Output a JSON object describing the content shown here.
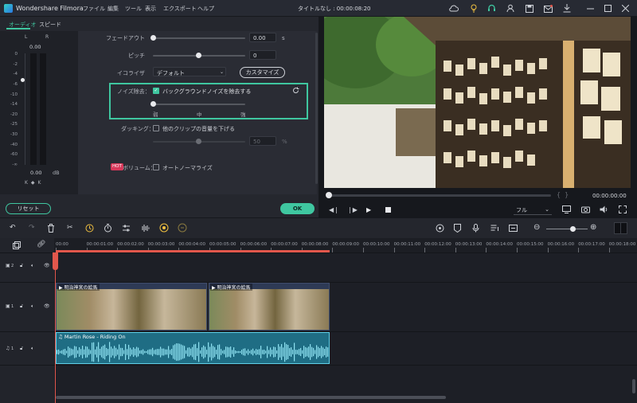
{
  "titlebar": {
    "app_name": "Wondershare Filmora",
    "menus": [
      "ファイル",
      "編集",
      "ツール",
      "表示",
      "エクスポート",
      "ヘルプ"
    ],
    "document_title": "タイトルなし : 00:00:08:20"
  },
  "left_panel": {
    "tabs": [
      {
        "label": "オーディオ",
        "active": true
      },
      {
        "label": "スピード",
        "active": false
      }
    ],
    "meter": {
      "channel_left": "L",
      "channel_right": "R",
      "peak_value": "0.00",
      "scale": [
        "0",
        "-2",
        "-4",
        "-6",
        "-10",
        "-14",
        "-20",
        "-25",
        "-30",
        "-40",
        "-60",
        "-∞"
      ],
      "bottom_value": "0.00",
      "bottom_unit": "dB"
    },
    "settings": {
      "fade_out": {
        "label": "フェードアウト",
        "value": "0.00",
        "unit": "s",
        "level": 0.0
      },
      "pitch": {
        "label": "ピッチ",
        "value": "0",
        "level": 0.5
      },
      "equalizer": {
        "label": "イコライザ",
        "value": "デフォルト",
        "button": "カスタマイズ"
      },
      "noise_removal": {
        "label": "ノイズ除去：",
        "checkbox_label": "バックグラウンドノイズを除去する",
        "checked": true,
        "levels": [
          "弱",
          "中",
          "強"
        ],
        "level": 0.0
      },
      "ducking": {
        "label": "ダッキング：",
        "checkbox_label": "他のクリップの音量を下げる",
        "checked": false,
        "value": "50",
        "unit": "%",
        "level": 0.5
      },
      "auto_normalize": {
        "badge": "HOT",
        "label": "ボリューム：",
        "checkbox_label": "オートノーマライズ",
        "checked": false
      }
    },
    "reset_button": "リセット",
    "ok_button": "OK"
  },
  "preview": {
    "timecode": "00:00:00:00",
    "quality": "フル",
    "progress": 0.0
  },
  "timeline": {
    "ruler": [
      "00:00",
      "00:00:01:00",
      "00:00:02:00",
      "00:00:03:00",
      "00:00:04:00",
      "00:00:05:00",
      "00:00:06:00",
      "00:00:07:00",
      "00:00:08:00",
      "00:00:09:00",
      "00:00:10:00",
      "00:00:11:00",
      "00:00:12:00",
      "00:00:13:00",
      "00:00:14:00",
      "00:00:15:00",
      "00:00:16:00",
      "00:00:17:00",
      "00:00:18:00"
    ],
    "tracks": [
      {
        "id": "2",
        "type": "video"
      },
      {
        "id": "1",
        "type": "video"
      },
      {
        "id": "1",
        "type": "audio"
      }
    ],
    "video_clips": [
      {
        "title": "明治神宮の絵馬"
      },
      {
        "title": "明治神宮の絵馬"
      }
    ],
    "audio_clip": {
      "title": "Martin Rose - Riding On"
    },
    "colors": {
      "accent": "#3fc7a0",
      "audio_clip": "#1f6d84",
      "playhead": "#e2574c",
      "highlight_box": "#3fc7a0"
    }
  }
}
